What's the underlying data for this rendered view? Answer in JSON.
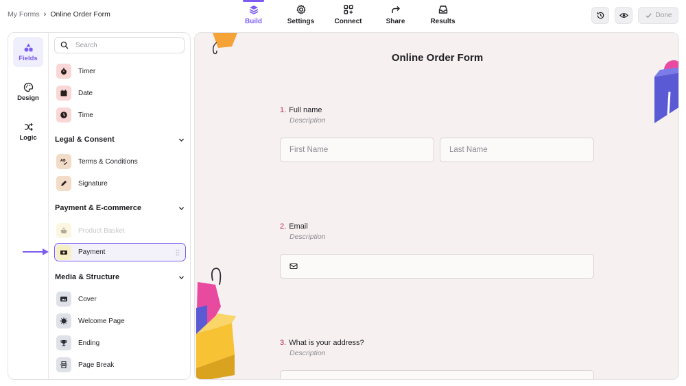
{
  "breadcrumb": {
    "root": "My Forms",
    "separator": "›",
    "current": "Online Order Form"
  },
  "nav": {
    "tabs": [
      {
        "label": "Build",
        "icon": "layers-icon",
        "active": true
      },
      {
        "label": "Settings",
        "icon": "gear-icon",
        "active": false
      },
      {
        "label": "Connect",
        "icon": "connect-icon",
        "active": false
      },
      {
        "label": "Share",
        "icon": "share-icon",
        "active": false
      },
      {
        "label": "Results",
        "icon": "inbox-icon",
        "active": false
      }
    ]
  },
  "toolbar": {
    "done_label": "Done"
  },
  "rail": {
    "items": [
      {
        "label": "Fields",
        "icon": "shapes-icon",
        "active": true
      },
      {
        "label": "Design",
        "icon": "palette-icon",
        "active": false
      },
      {
        "label": "Logic",
        "icon": "shuffle-icon",
        "active": false
      }
    ]
  },
  "search": {
    "placeholder": "Search"
  },
  "fields": {
    "timer": "Timer",
    "date": "Date",
    "time": "Time",
    "legal_header": "Legal & Consent",
    "terms": "Terms & Conditions",
    "signature": "Signature",
    "payment_header": "Payment & E-commerce",
    "basket": "Product Basket",
    "payment": "Payment",
    "media_header": "Media & Structure",
    "cover": "Cover",
    "welcome": "Welcome Page",
    "ending": "Ending",
    "pagebreak": "Page Break"
  },
  "form": {
    "title": "Online Order Form",
    "questions": [
      {
        "number": "1.",
        "title": "Full name",
        "description": "Description",
        "first_placeholder": "First Name",
        "last_placeholder": "Last Name"
      },
      {
        "number": "2.",
        "title": "Email",
        "description": "Description"
      },
      {
        "number": "3.",
        "title": "What is your address?",
        "description": "Description"
      }
    ]
  },
  "colors": {
    "accent": "#7c5cf0",
    "question_number": "#c0266b",
    "canvas_bg": "#f6f0f0"
  }
}
